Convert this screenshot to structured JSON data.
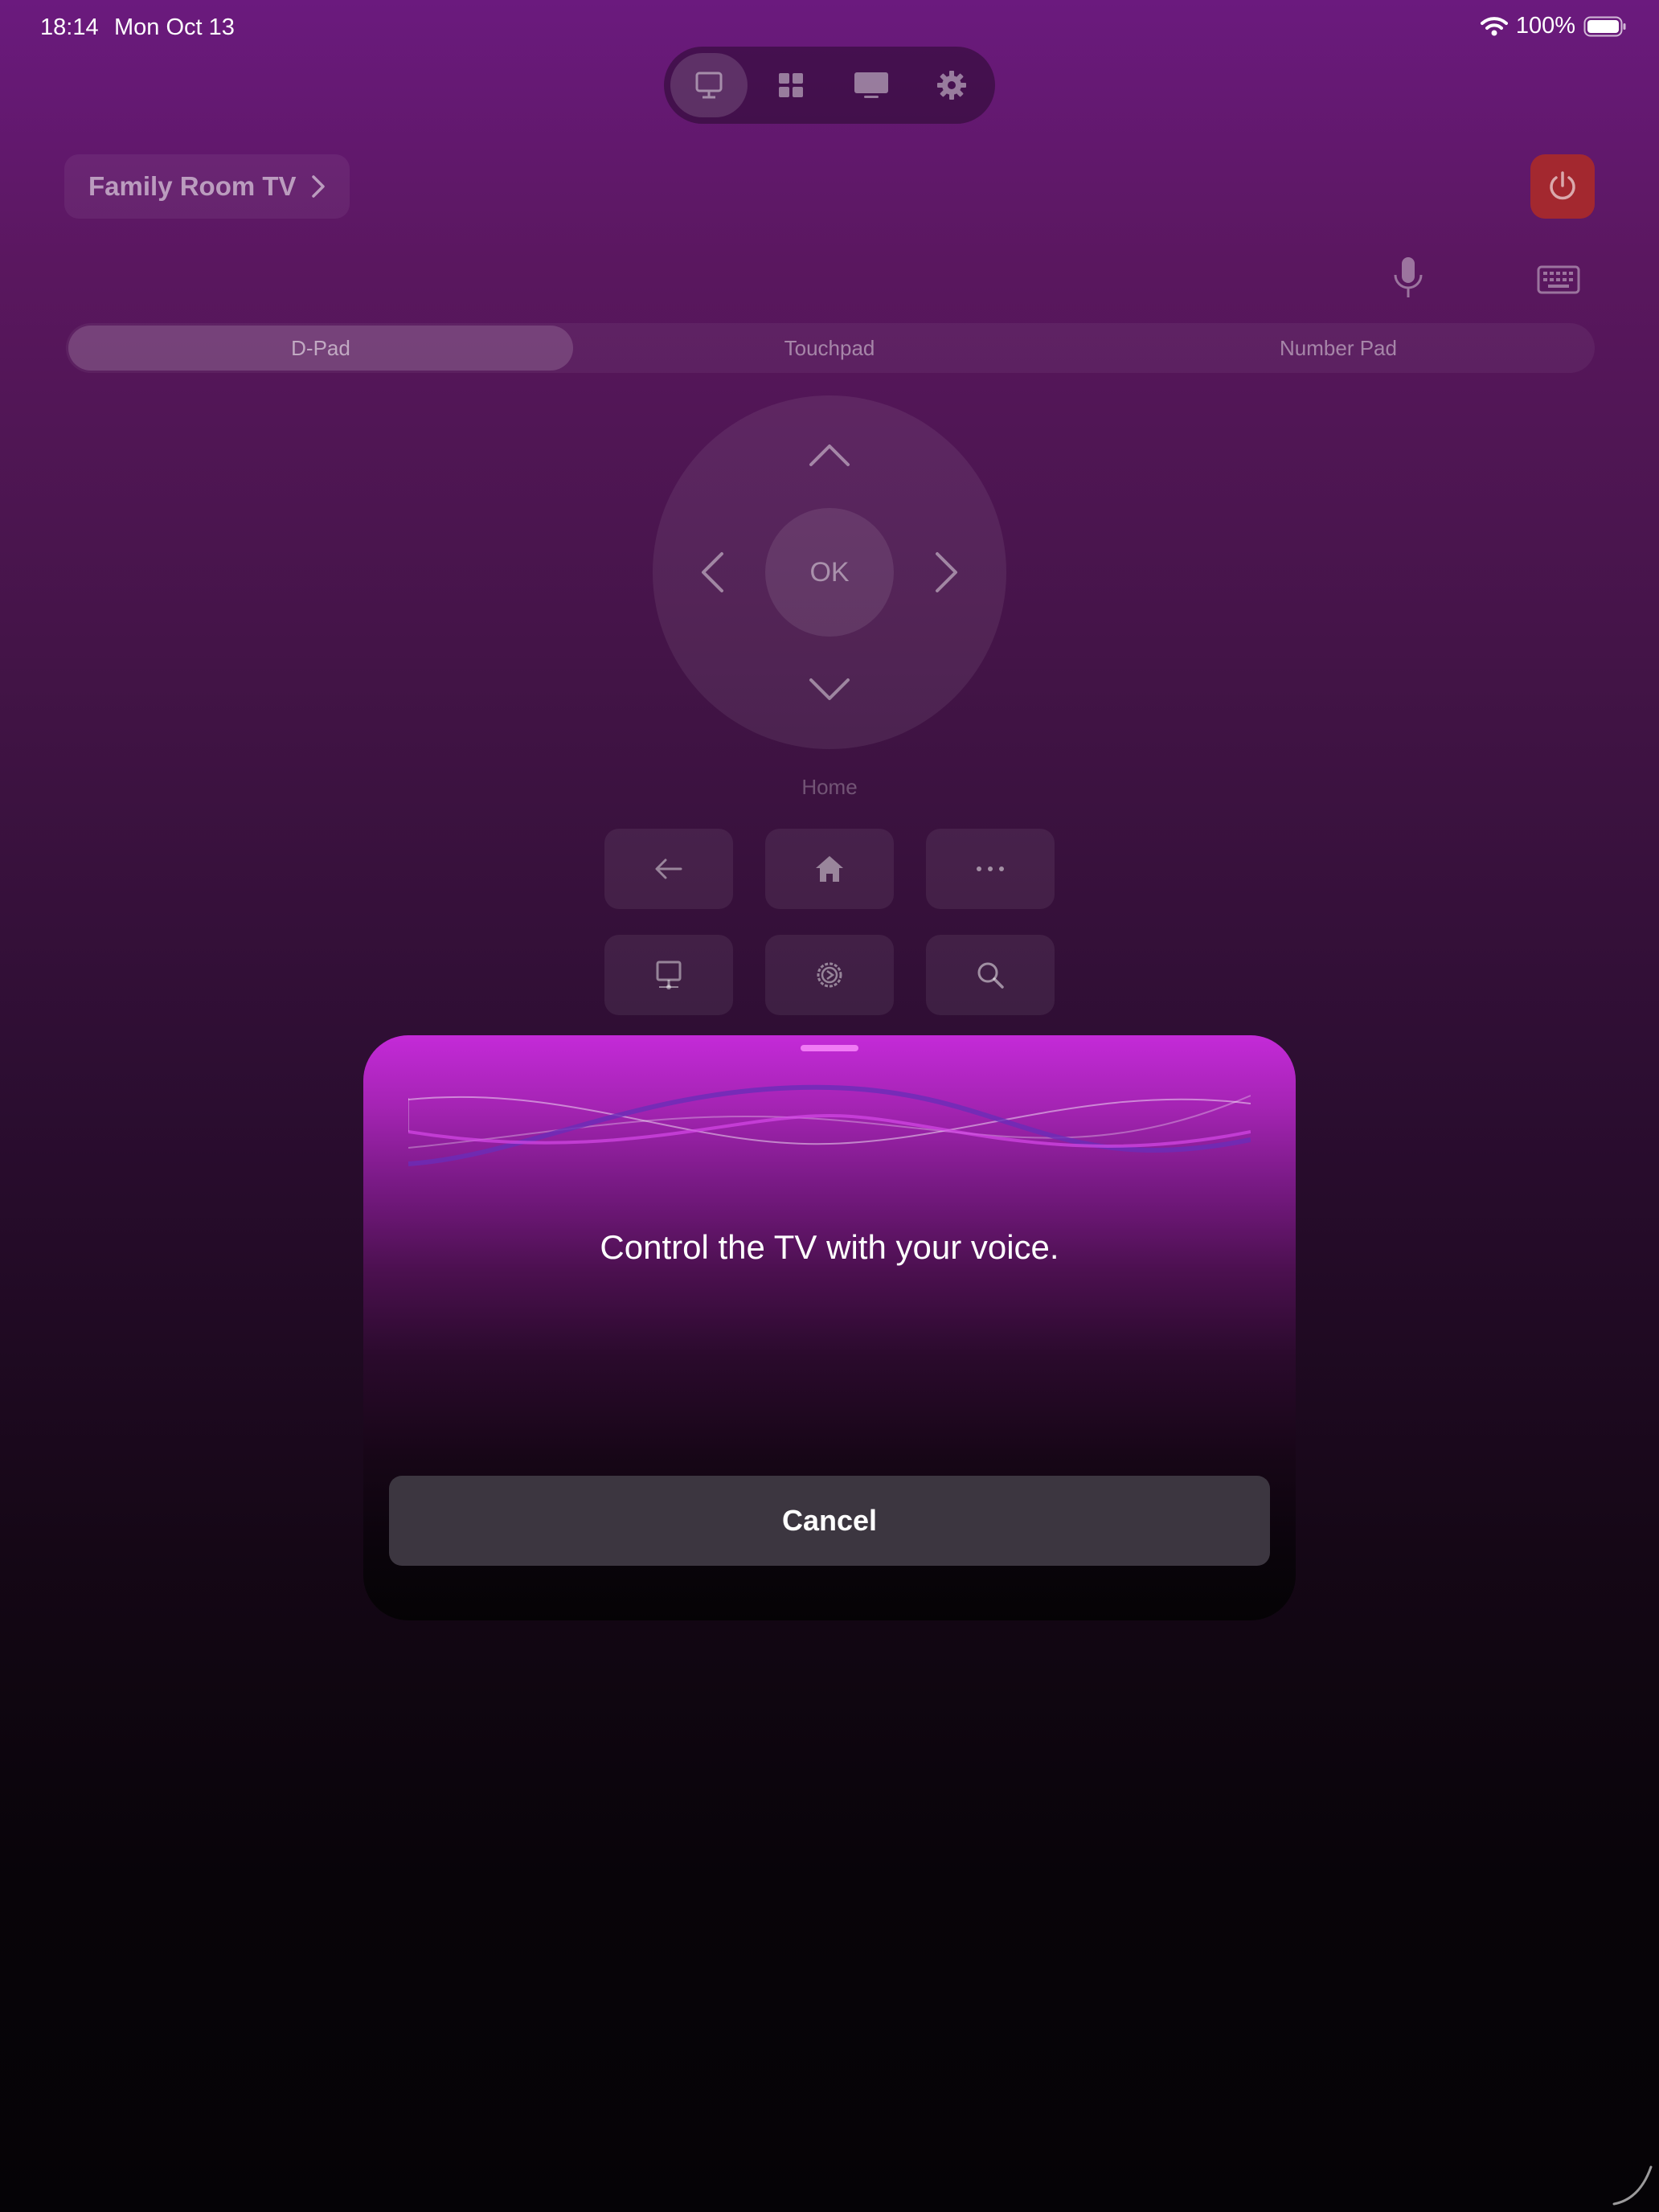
{
  "status_bar": {
    "time": "18:14",
    "date": "Mon Oct 13",
    "battery": "100%"
  },
  "top_nav": {
    "items": [
      "remote-icon",
      "apps-grid-icon",
      "tv-icon",
      "gear-icon"
    ],
    "active_index": 0
  },
  "device": {
    "name": "Family Room TV"
  },
  "input_modes": {
    "options": [
      "D-Pad",
      "Touchpad",
      "Number Pad"
    ],
    "selected": "D-Pad"
  },
  "dpad": {
    "ok_label": "OK"
  },
  "home_label": "Home",
  "buttons": [
    "back-arrow-icon",
    "home-icon",
    "more-dots-icon",
    "input-source-icon",
    "tv-settings-icon",
    "search-icon"
  ],
  "voice_sheet": {
    "prompt": "Control the TV with your voice.",
    "cancel_label": "Cancel"
  },
  "colors": {
    "power": "#a3282f",
    "sheet_top": "#c42ad8",
    "accent": "#f07af5",
    "background_top": "#6b1a7e"
  }
}
